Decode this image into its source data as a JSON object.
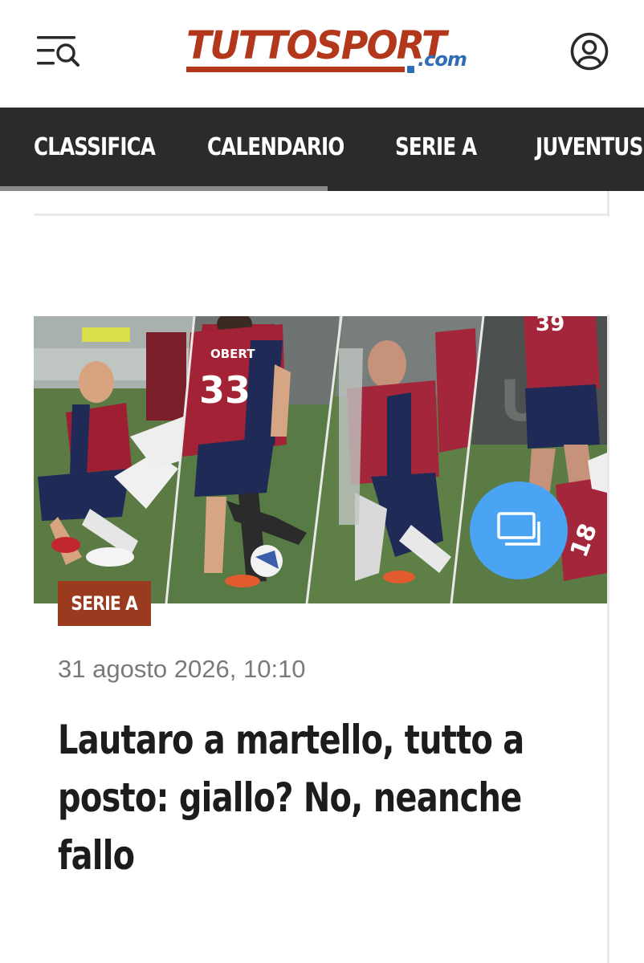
{
  "header": {
    "logo_main": "TUTTOSPORT",
    "logo_suffix": ".com",
    "icons": {
      "menu": "menu-search-icon",
      "user": "user-account-icon"
    }
  },
  "nav": {
    "items": [
      {
        "label": "CLASSIFICA"
      },
      {
        "label": "CALENDARIO"
      },
      {
        "label": "SERIE A"
      },
      {
        "label": "JUVENTUS"
      }
    ]
  },
  "article": {
    "category": "SERIE A",
    "date": "31 agosto 2026, 10:10",
    "headline": "Lautaro a martello, tutto a posto: giallo? No, neanche fallo",
    "image": {
      "description_icon": "gallery-icon",
      "jersey_numbers": [
        "33",
        "39",
        "18"
      ],
      "jersey_name": "OBERT"
    }
  },
  "colors": {
    "brand": "#b3371b",
    "brand_blue": "#2f6db6",
    "nav_background": "#2b2b2b",
    "badge": "#9a3b1f",
    "gallery_button": "#4aa3f3"
  }
}
